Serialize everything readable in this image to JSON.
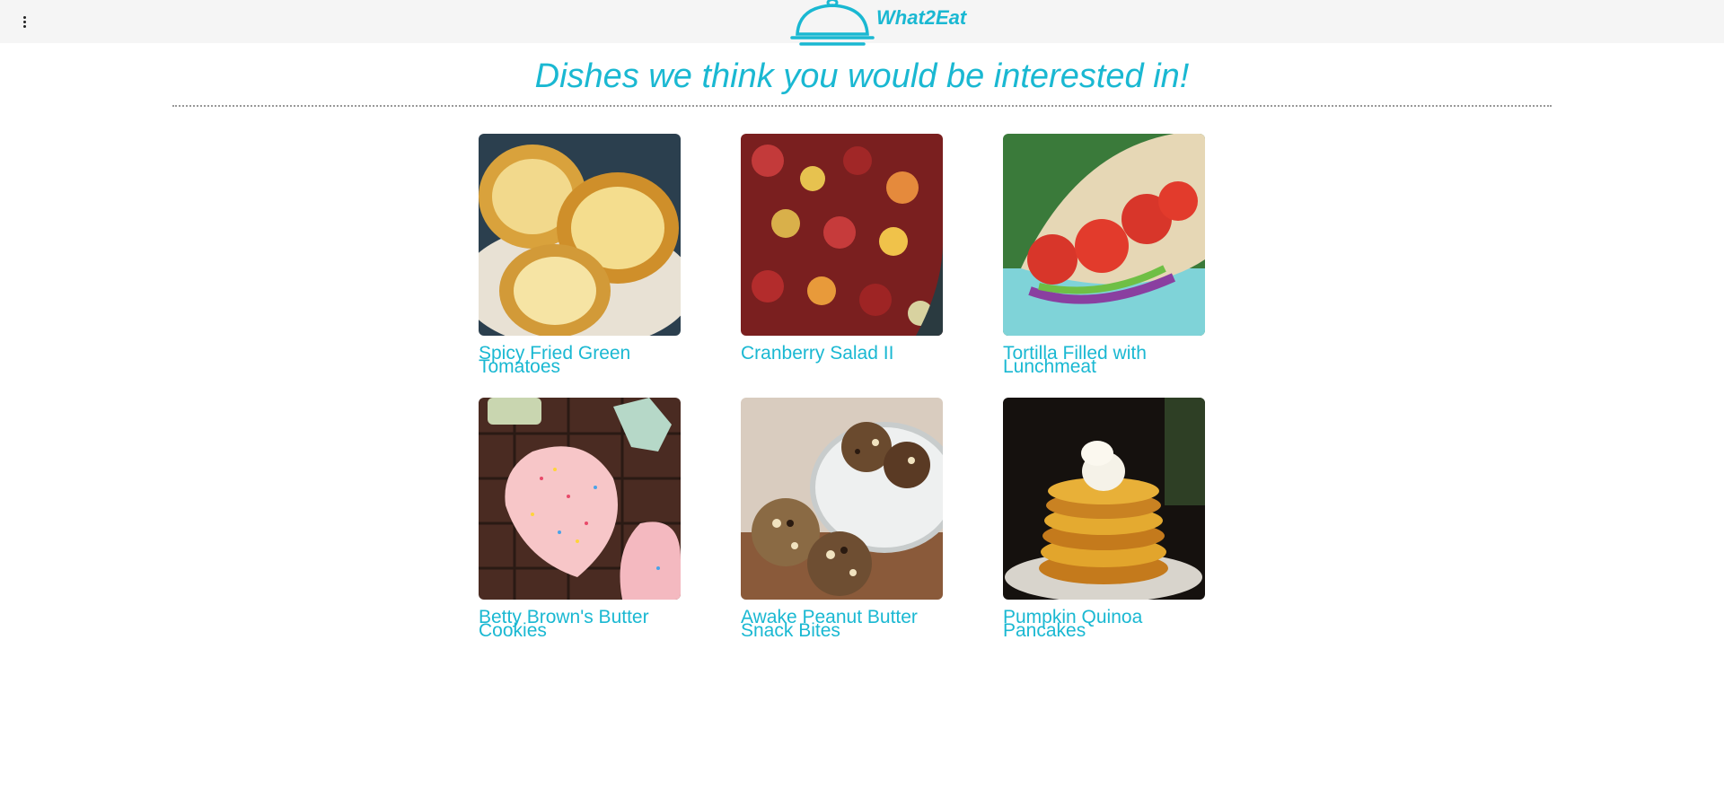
{
  "app": {
    "name": "What2Eat",
    "brand_color": "#1ab8d2"
  },
  "header": {
    "menu_icon": "more-vert-icon",
    "logo_icon": "cloche-icon"
  },
  "main": {
    "heading": "Dishes we think you would be interested in!",
    "dishes": [
      {
        "title": "Spicy Fried Green Tomatoes",
        "image": "fried-tomatoes-photo"
      },
      {
        "title": "Cranberry Salad II",
        "image": "cranberry-salad-photo"
      },
      {
        "title": "Tortilla Filled with Lunchmeat",
        "image": "tortilla-photo"
      },
      {
        "title": "Betty Brown's Butter Cookies",
        "image": "butter-cookies-photo"
      },
      {
        "title": "Awake Peanut Butter Snack Bites",
        "image": "snack-bites-photo"
      },
      {
        "title": "Pumpkin Quinoa Pancakes",
        "image": "pancakes-photo"
      }
    ]
  }
}
